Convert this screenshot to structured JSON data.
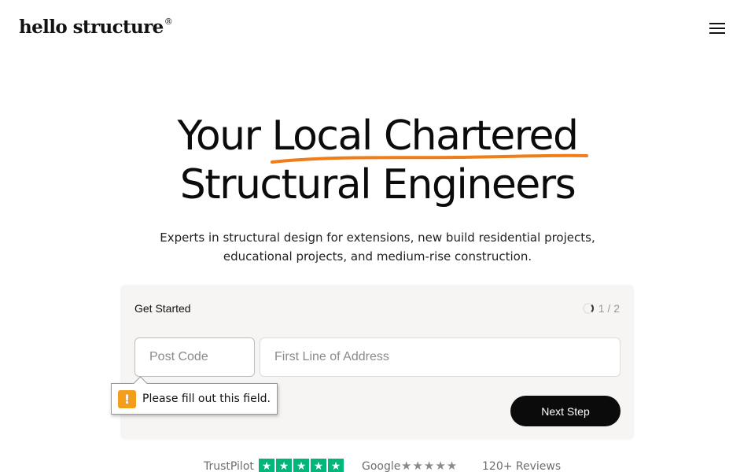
{
  "header": {
    "logo_text": "hello structure",
    "logo_mark": "®",
    "menu_icon": "hamburger-menu-icon"
  },
  "hero": {
    "title_line1_prefix": "Your ",
    "title_line1_highlight": "Local Chartered",
    "title_line2": "Structural Engineers",
    "subtitle_line1": "Experts in structural design for extensions, new build residential projects,",
    "subtitle_line2": "educational projects, and medium-rise construction.",
    "highlight_color": "#f07d1a"
  },
  "form": {
    "title": "Get Started",
    "step": "1 / 2",
    "postcode_placeholder": "Post Code",
    "address_placeholder": "First Line of Address",
    "next_label": "Next Step",
    "validation_message": "Please fill out this field.",
    "validation_icon_text": "!",
    "button_color": "#0b0b0b",
    "warning_color": "#f29d1c"
  },
  "reviews": {
    "trustpilot_label": "TrustPilot",
    "trustpilot_stars": 5,
    "trustpilot_color": "#00b67a",
    "google_label": "Google",
    "google_stars": "★★★★★",
    "count": "120+ Reviews"
  }
}
